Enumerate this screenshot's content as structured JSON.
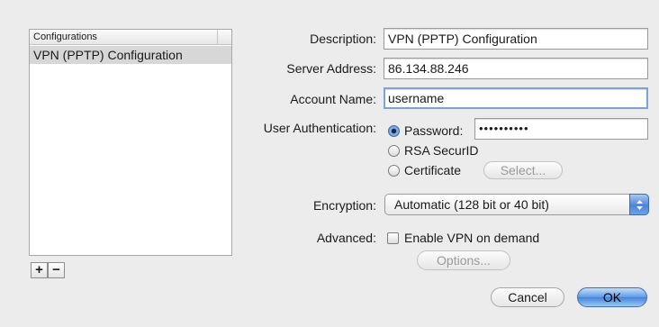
{
  "configurations": {
    "header": "Configurations",
    "items": [
      "VPN (PPTP) Configuration"
    ],
    "add_label": "+",
    "remove_label": "−"
  },
  "form": {
    "description_label": "Description:",
    "description_value": "VPN (PPTP) Configuration",
    "server_label": "Server Address:",
    "server_value": "86.134.88.246",
    "account_label": "Account Name:",
    "account_value": "username",
    "auth_label": "User Authentication:",
    "auth_options": {
      "password": "Password:",
      "rsa": "RSA SecurID",
      "certificate": "Certificate"
    },
    "auth_selected": "password",
    "password_value": "••••••••••",
    "select_button": "Select...",
    "encryption_label": "Encryption:",
    "encryption_value": "Automatic (128 bit or 40 bit)",
    "advanced_label": "Advanced:",
    "vpn_on_demand_label": "Enable VPN on demand",
    "vpn_on_demand_checked": false,
    "options_button": "Options..."
  },
  "buttons": {
    "cancel": "Cancel",
    "ok": "OK"
  },
  "colors": {
    "background": "#ececec",
    "accent": "#4c85d6",
    "selection": "#d7d7d7"
  }
}
